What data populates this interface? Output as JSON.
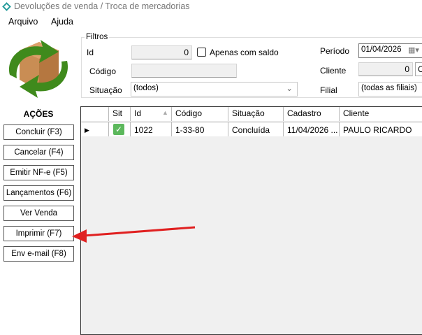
{
  "window": {
    "title": "Devoluções de venda / Troca de mercadorias"
  },
  "menu": [
    "Arquivo",
    "Ajuda"
  ],
  "filters": {
    "legend": "Filtros",
    "id_label": "Id",
    "id_value": "0",
    "only_balance_label": "Apenas com saldo",
    "only_balance_checked": false,
    "codigo_label": "Código",
    "codigo_value": "",
    "situacao_label": "Situação",
    "situacao_value": "(todos)",
    "periodo_label": "Período",
    "periodo_value": "01/04/2026",
    "cliente_label": "Cliente",
    "cliente_value": "0",
    "cliente_btn": "C",
    "filial_label": "Filial",
    "filial_value": "(todas as filiais)"
  },
  "actions": {
    "title": "AÇÕES",
    "buttons": [
      "Concluir (F3)",
      "Cancelar (F4)",
      "Emitir NF-e (F5)",
      "Lançamentos (F6)",
      "Ver Venda",
      "Imprimir (F7)",
      "Env e-mail (F8)"
    ]
  },
  "grid": {
    "columns": [
      "Sit",
      "Id",
      "Código",
      "Situação",
      "Cadastro",
      "Cliente"
    ],
    "sorted_column": "Id",
    "rows": [
      {
        "sit": "check",
        "id": "1022",
        "codigo": "1-33-80",
        "situacao": "Concluída",
        "cadastro": "11/04/2026 ...",
        "cliente": "PAULO RICARDO"
      }
    ]
  },
  "colors": {
    "accent_arrow": "#e02020",
    "check_green": "#5cb85c"
  }
}
